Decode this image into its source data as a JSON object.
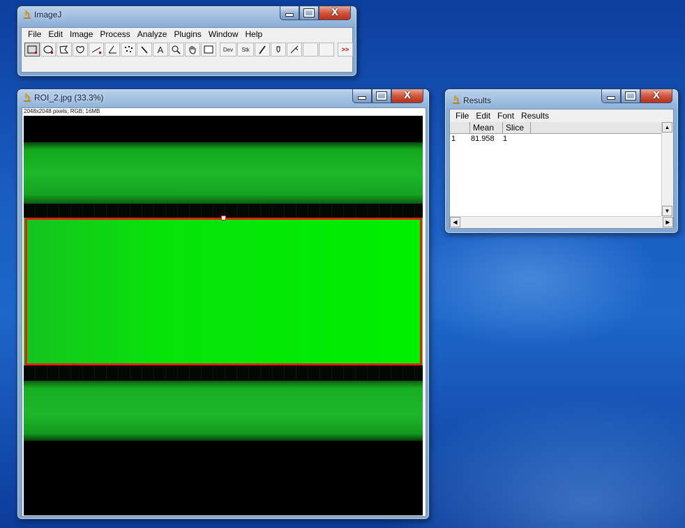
{
  "imagej": {
    "title": "ImageJ",
    "menu": [
      "File",
      "Edit",
      "Image",
      "Process",
      "Analyze",
      "Plugins",
      "Window",
      "Help"
    ],
    "tools": [
      "rectangle-tool",
      "oval-tool",
      "polygon-tool",
      "freehand-tool",
      "line-tool",
      "angle-tool",
      "point-tool",
      "wand-tool",
      "text-tool",
      "magnifier-tool",
      "hand-tool",
      "color-picker-tool",
      "dev",
      "stk",
      "pencil-tool",
      "paintbrush-tool",
      "flood-fill-tool",
      "blank-tool",
      "blank-tool",
      "more-tools"
    ],
    "dev_label": "Dev",
    "stk_label": "Stk",
    "text_tool_label": "A",
    "more_label": ">>"
  },
  "image_window": {
    "title": "ROI_2.jpg (33.3%)",
    "info": "2048x2048 pixels; RGB; 16MB"
  },
  "results": {
    "title": "Results",
    "menu": [
      "File",
      "Edit",
      "Font",
      "Results"
    ],
    "columns": [
      "",
      "Mean",
      "Slice"
    ],
    "rows": [
      [
        "1",
        "81.958",
        "1"
      ]
    ]
  },
  "colors": {
    "roi": "#e41e12",
    "green": "#00e600",
    "dim_green": "#0a8a12"
  }
}
